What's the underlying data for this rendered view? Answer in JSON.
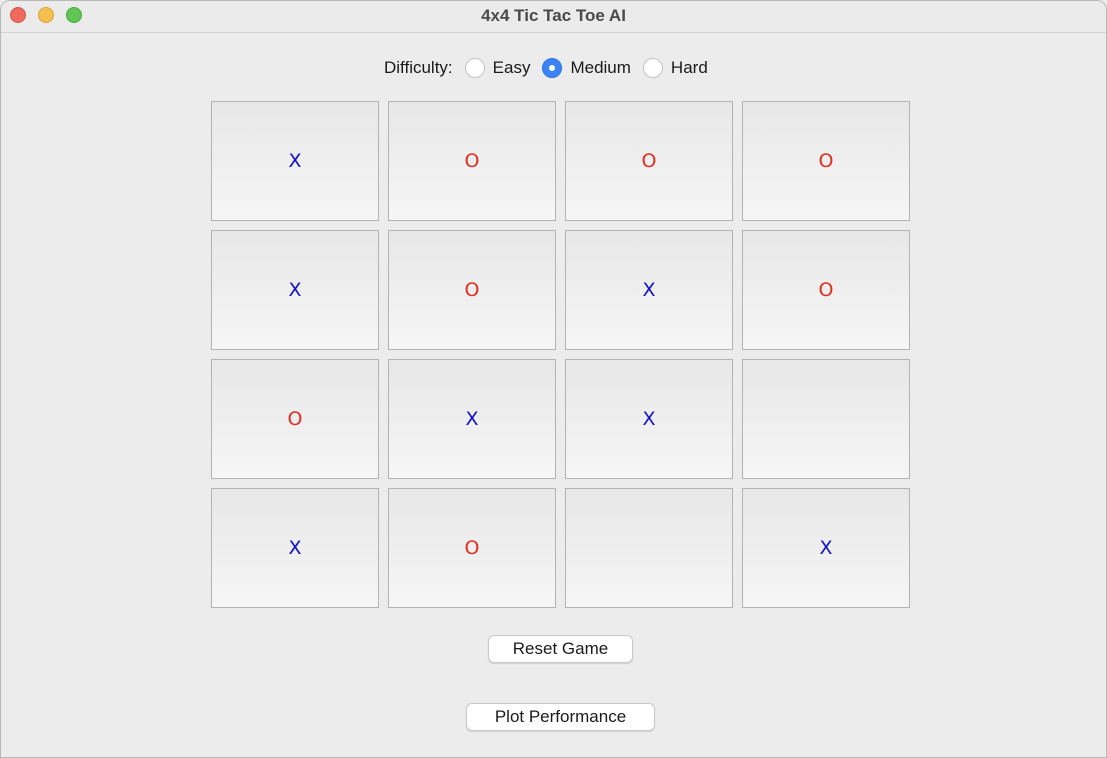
{
  "window": {
    "title": "4x4 Tic Tac Toe AI"
  },
  "difficulty": {
    "label": "Difficulty:",
    "options": [
      {
        "label": "Easy",
        "selected": false
      },
      {
        "label": "Medium",
        "selected": true
      },
      {
        "label": "Hard",
        "selected": false
      }
    ]
  },
  "board": {
    "rows": [
      [
        "X",
        "O",
        "O",
        "O"
      ],
      [
        "X",
        "O",
        "X",
        "O"
      ],
      [
        "O",
        "X",
        "X",
        ""
      ],
      [
        "X",
        "O",
        "",
        "X"
      ]
    ]
  },
  "buttons": {
    "reset_label": "Reset Game",
    "plot_label": "Plot Performance"
  },
  "colors": {
    "x_mark": "#1010d0",
    "o_mark": "#e03020",
    "radio_selected": "#3b82f6"
  }
}
